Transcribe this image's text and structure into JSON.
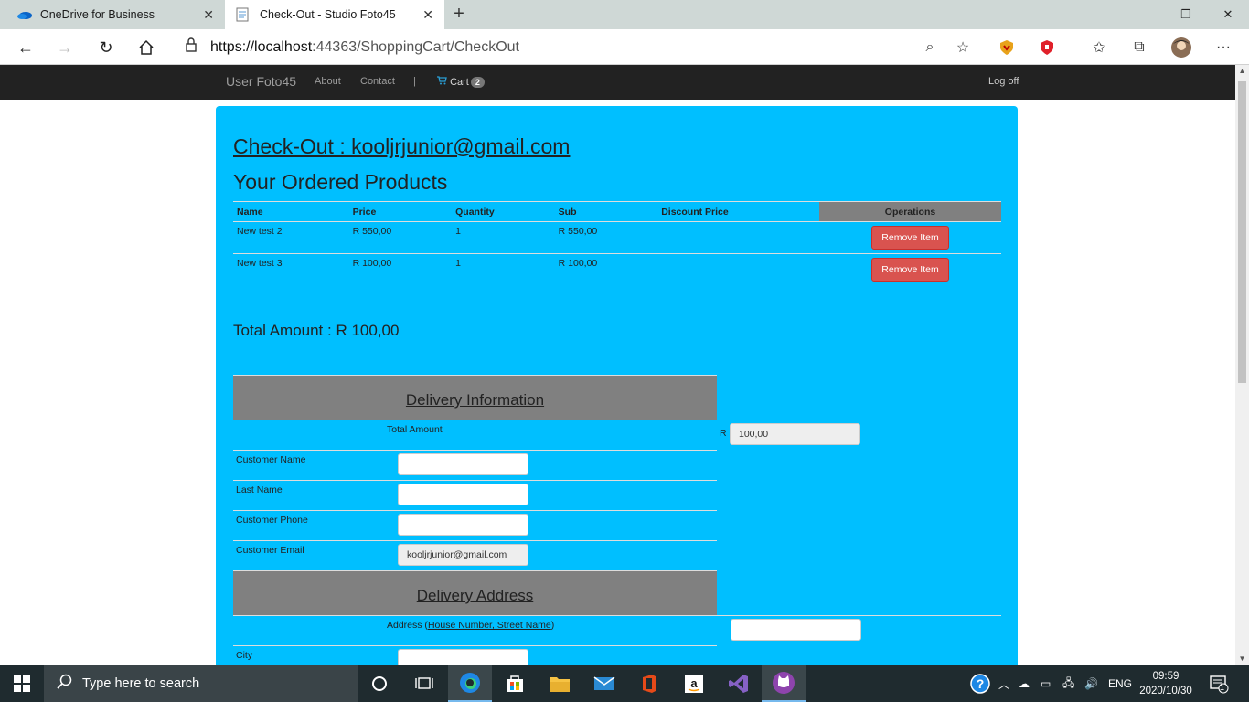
{
  "browser": {
    "tabs": [
      {
        "title": "OneDrive for Business",
        "active": false
      },
      {
        "title": "Check-Out - Studio Foto45",
        "active": true
      }
    ],
    "url_host": "https://localhost",
    "url_rest": ":44363/ShoppingCart/CheckOut"
  },
  "site_nav": {
    "brand": "User Foto45",
    "about": "About",
    "contact": "Contact",
    "separator": "|",
    "cart_label": "Cart",
    "cart_count": "2",
    "logoff": "Log off"
  },
  "checkout": {
    "heading": "Check-Out : kooljrjunior@gmail.com",
    "ordered_heading": "Your Ordered Products",
    "columns": [
      "Name",
      "Price",
      "Quantity",
      "Sub",
      "Discount Price",
      "Operations"
    ],
    "rows": [
      {
        "name": "New test 2",
        "price": "R 550,00",
        "quantity": "1",
        "sub": "R 550,00",
        "discount": "",
        "action": "Remove Item"
      },
      {
        "name": "New test 3",
        "price": "R 100,00",
        "quantity": "1",
        "sub": "R 100,00",
        "discount": "",
        "action": "Remove Item"
      }
    ],
    "total_amount": "Total Amount : R 100,00"
  },
  "delivery": {
    "heading": "Delivery Information",
    "total_label": "Total Amount",
    "currency": "R",
    "total_value": "100,00",
    "customer_name_label": "Customer Name",
    "last_name_label": "Last Name",
    "phone_label": "Customer Phone",
    "email_label": "Customer Email",
    "email_value": "kooljrjunior@gmail.com",
    "address_heading": "Delivery Address",
    "address_label_prefix": "Address (",
    "address_label_link": "House Number, Street Name",
    "address_label_suffix": ")",
    "city_label": "City"
  },
  "taskbar": {
    "search_placeholder": "Type here to search",
    "language": "ENG",
    "time": "09:59",
    "date": "2020/10/30",
    "notification_count": "1"
  },
  "colors": {
    "panel": "#00bfff",
    "section_header": "#808080",
    "remove_button": "#d9534f",
    "navbar": "#222222"
  }
}
